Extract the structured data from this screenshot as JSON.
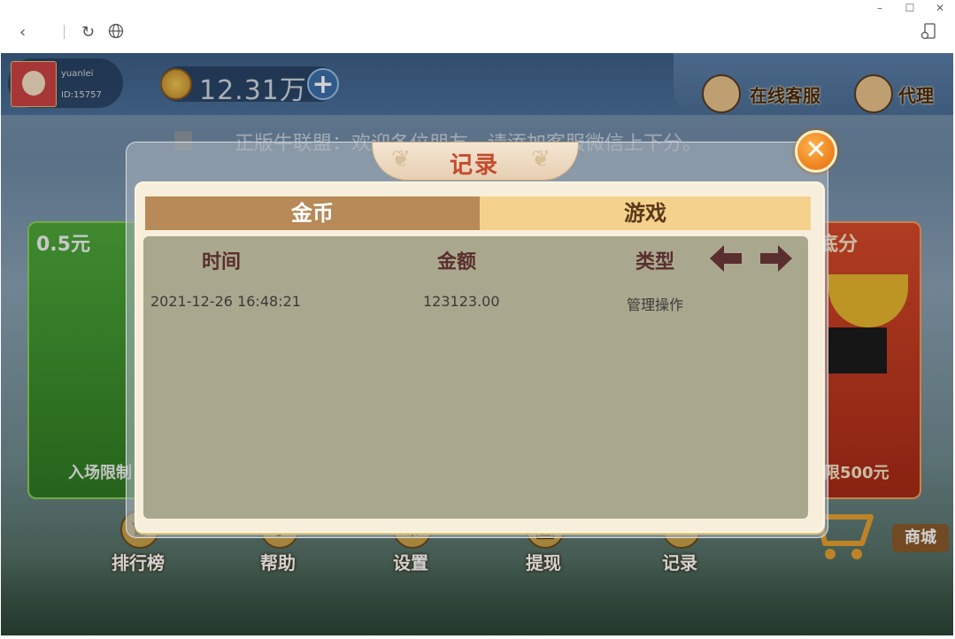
{
  "browser": {
    "window_controls": [
      "–",
      "☐",
      "✕"
    ],
    "nav_icons": [
      "chevron-left-icon",
      "refresh-icon",
      "globe-icon",
      "device-icon"
    ]
  },
  "header": {
    "username": "yuanlei",
    "user_id": "ID:15757",
    "coin_balance": "12.31万",
    "service_label": "在线客服",
    "agent_label": "代理"
  },
  "marquee": "正版牛联盟：欢迎各位朋友，请添加客服微信上下分。",
  "background_cards": {
    "left_title": "0.5元",
    "left_footer": "入场限制",
    "right_title": "底分",
    "right_footer": "限500元"
  },
  "dialog": {
    "title": "记录",
    "close_symbol": "✕",
    "tabs": [
      {
        "label": "金币",
        "active": true
      },
      {
        "label": "游戏",
        "active": false
      }
    ],
    "columns": [
      "时间",
      "金额",
      "类型"
    ],
    "rows": [
      {
        "time": "2021-12-26 16:48:21",
        "amount": "123123.00",
        "type": "管理操作"
      }
    ]
  },
  "bottom_nav": [
    {
      "label": "排行榜",
      "icon": "trophy-icon"
    },
    {
      "label": "帮助",
      "icon": "question-icon"
    },
    {
      "label": "设置",
      "icon": "gear-icon"
    },
    {
      "label": "提现",
      "icon": "withdraw-icon"
    },
    {
      "label": "记录",
      "icon": "record-icon"
    }
  ],
  "shop_label": "商城",
  "colors": {
    "tab_active": "#b88a58",
    "tab_inactive": "#f5d28c",
    "panel": "#a9a88e",
    "title_text": "#c44a2e",
    "close_button": "#f08c1a"
  }
}
